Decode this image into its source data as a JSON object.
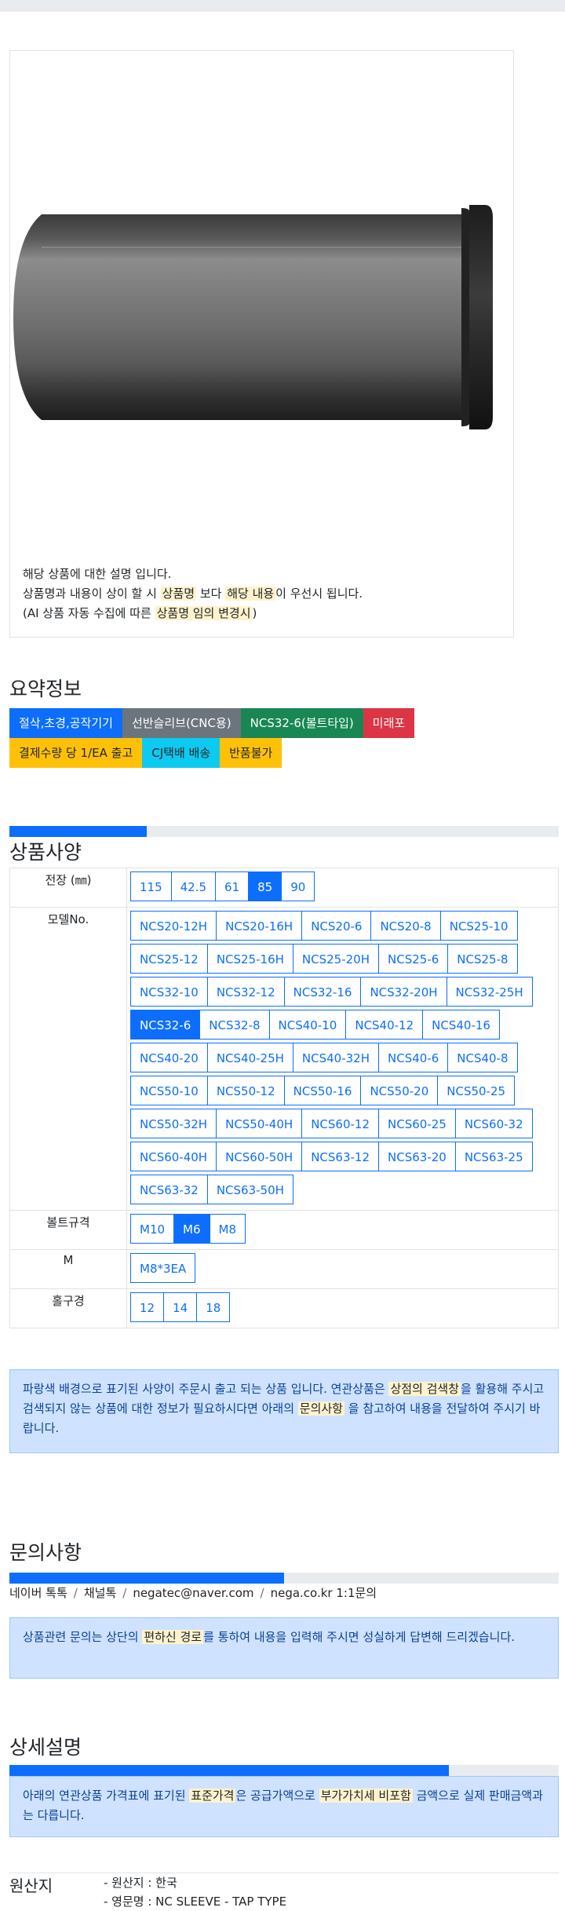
{
  "product_image": {
    "desc_line1": "해당 상품에 대한 설명 입니다.",
    "desc_line2_pre": "상품명과 내용이 상이 할 시 ",
    "desc_line2_mark1": "상품명",
    "desc_line2_mid": " 보다 ",
    "desc_line2_mark2": "해당 내용",
    "desc_line2_post": "이 우선시 됩니다.",
    "desc_line3_pre": "(AI 상품 자동 수집에 따른 ",
    "desc_line3_mark": "상품명 임의 변경시",
    "desc_line3_post": ")"
  },
  "summary": {
    "title": "요약정보",
    "badges_row1": [
      {
        "label": "절삭,초경,공작기기",
        "color": "#0d6efd"
      },
      {
        "label": "선반슬리브(CNC용)",
        "color": "#6c757d"
      },
      {
        "label": "NCS32-6(볼트타입)",
        "color": "#198754"
      },
      {
        "label": "미래포",
        "color": "#dc3545"
      }
    ],
    "badges_row2": [
      {
        "label": "결제수량 당 1/EA 출고",
        "color": "#ffc107",
        "text": "#212529"
      },
      {
        "label": "CJ택배 배송",
        "color": "#0dcaf0",
        "text": "#212529"
      },
      {
        "label": "반품불가",
        "color": "#ffc107",
        "text": "#212529"
      }
    ]
  },
  "specs": {
    "title": "상품사양",
    "progress": 0.25,
    "rows": [
      {
        "label": "전장 (㎜)",
        "options": [
          "115",
          "42.5",
          "61",
          "85",
          "90"
        ],
        "selected": "85"
      },
      {
        "label": "모델No.",
        "options": [
          "NCS20-12H",
          "NCS20-16H",
          "NCS20-6",
          "NCS20-8",
          "NCS25-10",
          "NCS25-12",
          "NCS25-16H",
          "NCS25-20H",
          "NCS25-6",
          "NCS25-8",
          "NCS32-10",
          "NCS32-12",
          "NCS32-16",
          "NCS32-20H",
          "NCS32-25H",
          "NCS32-6",
          "NCS32-8",
          "NCS40-10",
          "NCS40-12",
          "NCS40-16",
          "NCS40-20",
          "NCS40-25H",
          "NCS40-32H",
          "NCS40-6",
          "NCS40-8",
          "NCS50-10",
          "NCS50-12",
          "NCS50-16",
          "NCS50-20",
          "NCS50-25",
          "NCS50-32H",
          "NCS50-40H",
          "NCS60-12",
          "NCS60-25",
          "NCS60-32",
          "NCS60-40H",
          "NCS60-50H",
          "NCS63-12",
          "NCS63-20",
          "NCS63-25",
          "NCS63-32",
          "NCS63-50H"
        ],
        "selected": "NCS32-6"
      },
      {
        "label": "볼트규격",
        "options": [
          "M10",
          "M6",
          "M8"
        ],
        "selected": "M6"
      },
      {
        "label": "M",
        "options": [
          "M8*3EA"
        ],
        "selected": ""
      },
      {
        "label": "홀구경",
        "options": [
          "12",
          "14",
          "18"
        ],
        "selected": ""
      }
    ],
    "notice_pre": "파랑색 배경으로 표기된 사양이 주문시 출고 되는 상품 입니다. 연관상품은 ",
    "notice_mark1": "상점의 검색창",
    "notice_mid": "을 활용해 주시고 검색되지 않는 상품에 대한 정보가 필요하시다면 아래의 ",
    "notice_mark2": "문의사항",
    "notice_post": " 을 참고하여 내용을 전달하여 주시기 바랍니다."
  },
  "inquiry": {
    "title": "문의사항",
    "progress": 0.5,
    "contacts": [
      "네이버 톡톡",
      "채널톡",
      "negatec@naver.com",
      "nega.co.kr 1:1문의"
    ],
    "notice_pre": "상품관련 문의는 상단의 ",
    "notice_mark": "편하신 경로",
    "notice_post": "를 통하여 내용을 입력해 주시면 성실하게 답변해 드리겠습니다."
  },
  "detail": {
    "title": "상세설명",
    "progress": 0.8,
    "notice_pre": "아래의 연관상품 가격표에 표기된 ",
    "notice_mark1": "표준가격",
    "notice_mid": "은 공급가액으로 ",
    "notice_mark2": "부가가치세 비포함",
    "notice_post": " 금액으로 실제 판매금액과는 다릅니다."
  },
  "origin": {
    "label": "원산지",
    "country": "- 원산지 : 한국",
    "english_name": "- 영문명 : NC SLEEVE - TAP TYPE"
  }
}
